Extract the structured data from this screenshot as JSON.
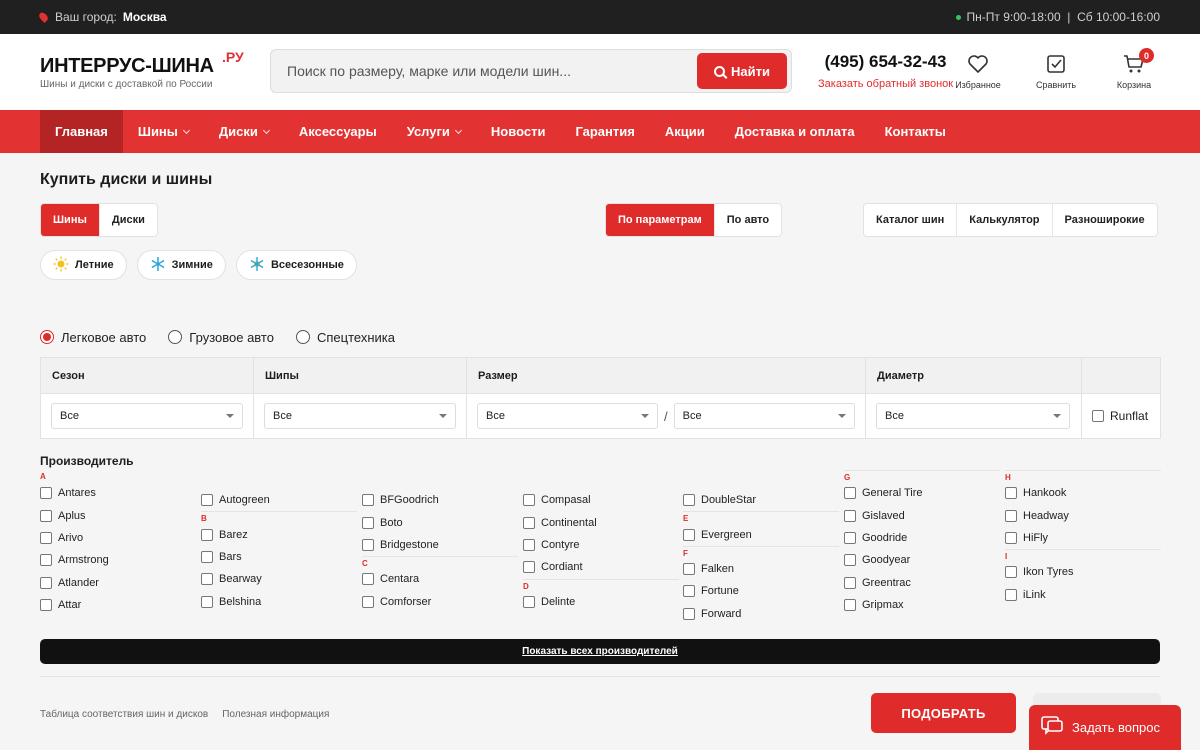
{
  "topbar": {
    "city_label": "Ваш город:",
    "city": "Москва",
    "hours": "Пн-Пт 9:00-18:00  |  Сб 10:00-16:00"
  },
  "header": {
    "logo": "ИНТЕРРУС-ШИНА",
    "logo_sup": ".РУ",
    "logo_sub": "Шины и диски с доставкой по России",
    "search_placeholder": "Поиск по размеру, марке или модели шин...",
    "search_button": "Найти",
    "phone": "(495) 654-32-43",
    "callback": "Заказать обратный звонок",
    "icons": [
      {
        "name": "favorites",
        "label": "Избранное"
      },
      {
        "name": "compare",
        "label": "Сравнить"
      },
      {
        "name": "cart",
        "label": "Корзина",
        "badge": "0"
      }
    ]
  },
  "nav": [
    {
      "label": "Главная",
      "active": true,
      "dropdown": false
    },
    {
      "label": "Шины",
      "dropdown": true
    },
    {
      "label": "Диски",
      "dropdown": true
    },
    {
      "label": "Аксессуары",
      "dropdown": false
    },
    {
      "label": "Услуги",
      "dropdown": true
    },
    {
      "label": "Новости",
      "dropdown": false
    },
    {
      "label": "Гарантия",
      "dropdown": false
    },
    {
      "label": "Акции",
      "dropdown": false
    },
    {
      "label": "Доставка и оплата",
      "dropdown": false
    },
    {
      "label": "Контакты",
      "dropdown": false
    }
  ],
  "main": {
    "title": "Купить диски и шины",
    "product_tabs": [
      "Шины",
      "Диски"
    ],
    "mode_tabs": [
      "По параметрам",
      "По авто"
    ],
    "tool_tabs": [
      "Каталог шин",
      "Калькулятор",
      "Разноширокие"
    ],
    "seasons": [
      "Летние",
      "Зимние",
      "Всесезонные"
    ],
    "vehicle_types": [
      "Легковое авто",
      "Грузовое авто",
      "Спецтехника"
    ],
    "filter": {
      "headers": [
        "Сезон",
        "Шипы",
        "Размер",
        "Диаметр"
      ],
      "season": "Все",
      "studs": "Все",
      "width": "Все",
      "slash": "/",
      "profile": "Все",
      "diameter": "Все",
      "runflat": "Runflat"
    },
    "manufacturers_title": "Производитель",
    "manufacturers": [
      [
        {
          "letter": "A",
          "items": [
            "Antares",
            "Aplus",
            "Arivo",
            "Armstrong",
            "Atlander",
            "Attar"
          ]
        }
      ],
      [
        {
          "letter": "",
          "items": [
            "Autogreen"
          ]
        },
        {
          "letter": "B",
          "items": [
            "Barez",
            "Bars",
            "Bearway",
            "Belshina"
          ]
        }
      ],
      [
        {
          "letter": "",
          "items": [
            "BFGoodrich",
            "Boto",
            "Bridgestone"
          ]
        },
        {
          "letter": "C",
          "items": [
            "Centara",
            "Comforser"
          ]
        }
      ],
      [
        {
          "letter": "",
          "items": [
            "Compasal",
            "Continental",
            "Contyre",
            "Cordiant"
          ]
        },
        {
          "letter": "D",
          "items": [
            "Delinte"
          ]
        }
      ],
      [
        {
          "letter": "",
          "items": [
            "DoubleStar"
          ]
        },
        {
          "letter": "E",
          "items": [
            "Evergreen"
          ]
        },
        {
          "letter": "F",
          "items": [
            "Falken",
            "Fortune",
            "Forward"
          ]
        }
      ],
      [
        {
          "letter": "G",
          "items": [
            "General Tire",
            "Gislaved",
            "Goodride",
            "Goodyear",
            "Greentrac",
            "Gripmax"
          ]
        }
      ],
      [
        {
          "letter": "H",
          "items": [
            "Hankook",
            "Headway",
            "HiFly"
          ]
        },
        {
          "letter": "I",
          "items": [
            "Ikon Tyres",
            "iLink"
          ]
        }
      ]
    ],
    "show_all": "Показать всех производителей",
    "links": [
      "Таблица соответствия шин и дисков",
      "Полезная информация"
    ],
    "pick_button": "ПОДОБРАТЬ",
    "reset_button": "СБРОСИТЬ"
  },
  "chat": {
    "label": "Задать вопрос"
  }
}
